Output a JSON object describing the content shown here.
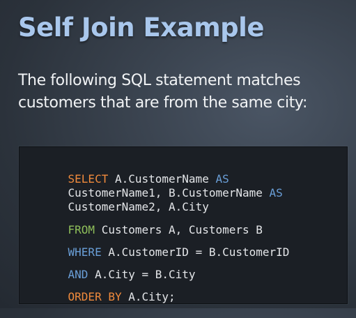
{
  "slide": {
    "title": "Self Join Example",
    "subtitle_lines": [
      "The following SQL statement matches",
      "customers that are from the same city:"
    ]
  },
  "code": {
    "lines": [
      {
        "tokens": [
          {
            "text": "SELECT",
            "style": "kw-orange"
          },
          {
            "text": " A.CustomerName ",
            "style": "plain"
          },
          {
            "text": "AS",
            "style": "kw-blue"
          }
        ]
      },
      {
        "tokens": [
          {
            "text": "CustomerName1, B.CustomerName ",
            "style": "plain"
          },
          {
            "text": "AS",
            "style": "kw-blue"
          }
        ]
      },
      {
        "tokens": [
          {
            "text": "CustomerName2, A.City",
            "style": "plain"
          }
        ]
      },
      {
        "tokens": [
          {
            "text": "FROM",
            "style": "kw-green"
          },
          {
            "text": " Customers A, Customers B",
            "style": "plain"
          }
        ]
      },
      {
        "tokens": [
          {
            "text": "WHERE",
            "style": "kw-blue"
          },
          {
            "text": " A.CustomerID = B.CustomerID",
            "style": "plain"
          }
        ]
      },
      {
        "tokens": [
          {
            "text": "AND",
            "style": "kw-blue"
          },
          {
            "text": " A.City = B.City",
            "style": "plain"
          }
        ]
      },
      {
        "tokens": [
          {
            "text": "ORDER BY",
            "style": "kw-orange"
          },
          {
            "text": " A.City;",
            "style": "plain"
          }
        ]
      }
    ]
  },
  "colors": {
    "title": "#a9c7ec",
    "keyword_orange": "#f08a3c",
    "keyword_blue": "#6a9fd8",
    "keyword_green": "#8fbf5a",
    "code_text": "#e4e6e9",
    "code_background": "#1b1f25"
  }
}
